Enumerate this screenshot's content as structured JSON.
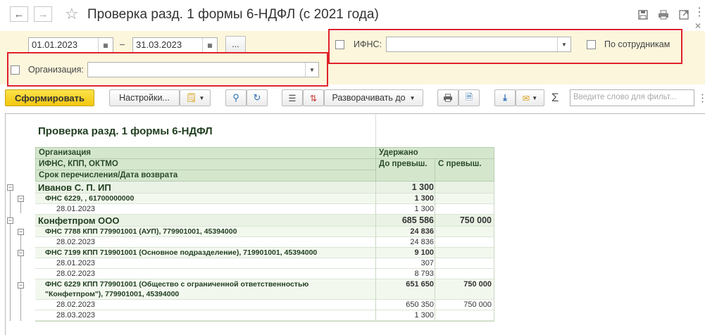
{
  "window": {
    "title": "Проверка разд. 1 формы 6-НДФЛ (с 2021 года)",
    "back_icon": "arrow-left-icon",
    "forward_icon": "arrow-right-icon"
  },
  "filters": {
    "date_from": "01.01.2023",
    "date_sep": "–",
    "date_to": "31.03.2023",
    "period_button": "...",
    "ifns_label": "ИФНС:",
    "ifns_value": "",
    "by_employees_label": "По сотрудникам",
    "org_label": "Организация:",
    "org_value": ""
  },
  "toolbar": {
    "generate_label": "Сформировать",
    "settings_label": "Настройки...",
    "expand_label": "Разворачивать до",
    "search_placeholder": "Введите слово для фильт...",
    "sigma": "Σ"
  },
  "report": {
    "title": "Проверка разд. 1 формы 6-НДФЛ",
    "headers": {
      "org": "Организация",
      "ifns": "ИФНС, КПП, ОКТМО",
      "term": "Срок перечисления/Дата возврата",
      "withheld": "Удержано",
      "below": "До превыш.",
      "above": "С превыш."
    },
    "rows": [
      {
        "label": "Иванов С. П. ИП",
        "v1": "1 300",
        "v2": "",
        "level": 1
      },
      {
        "label": "ФНС 6229, , 61700000000",
        "v1": "1 300",
        "v2": "",
        "level": 2
      },
      {
        "label": "28.01.2023",
        "v1": "1 300",
        "v2": "",
        "level": 3
      },
      {
        "label": "Конфетпром ООО",
        "v1": "685 586",
        "v2": "750 000",
        "level": 1
      },
      {
        "label": "ФНС 7788 КПП 779901001 (АУП), 779901001, 45394000",
        "v1": "24 836",
        "v2": "",
        "level": 2
      },
      {
        "label": "28.02.2023",
        "v1": "24 836",
        "v2": "",
        "level": 3
      },
      {
        "label": "ФНС 7199 КПП 719901001 (Основное подразделение), 719901001, 45394000",
        "v1": "9 100",
        "v2": "",
        "level": 2
      },
      {
        "label": "28.01.2023",
        "v1": "307",
        "v2": "",
        "level": 3
      },
      {
        "label": "28.02.2023",
        "v1": "8 793",
        "v2": "",
        "level": 3
      },
      {
        "label": "ФНС 6229 КПП 779901001 (Общество с ограниченной ответственностью",
        "label2": "\"Конфетпром\"), 779901001, 45394000",
        "v1": "651 650",
        "v2": "750 000",
        "level": 2
      },
      {
        "label": "28.02.2023",
        "v1": "650 350",
        "v2": "750 000",
        "level": 3
      },
      {
        "label": "28.03.2023",
        "v1": "1 300",
        "v2": "",
        "level": 3
      }
    ]
  }
}
